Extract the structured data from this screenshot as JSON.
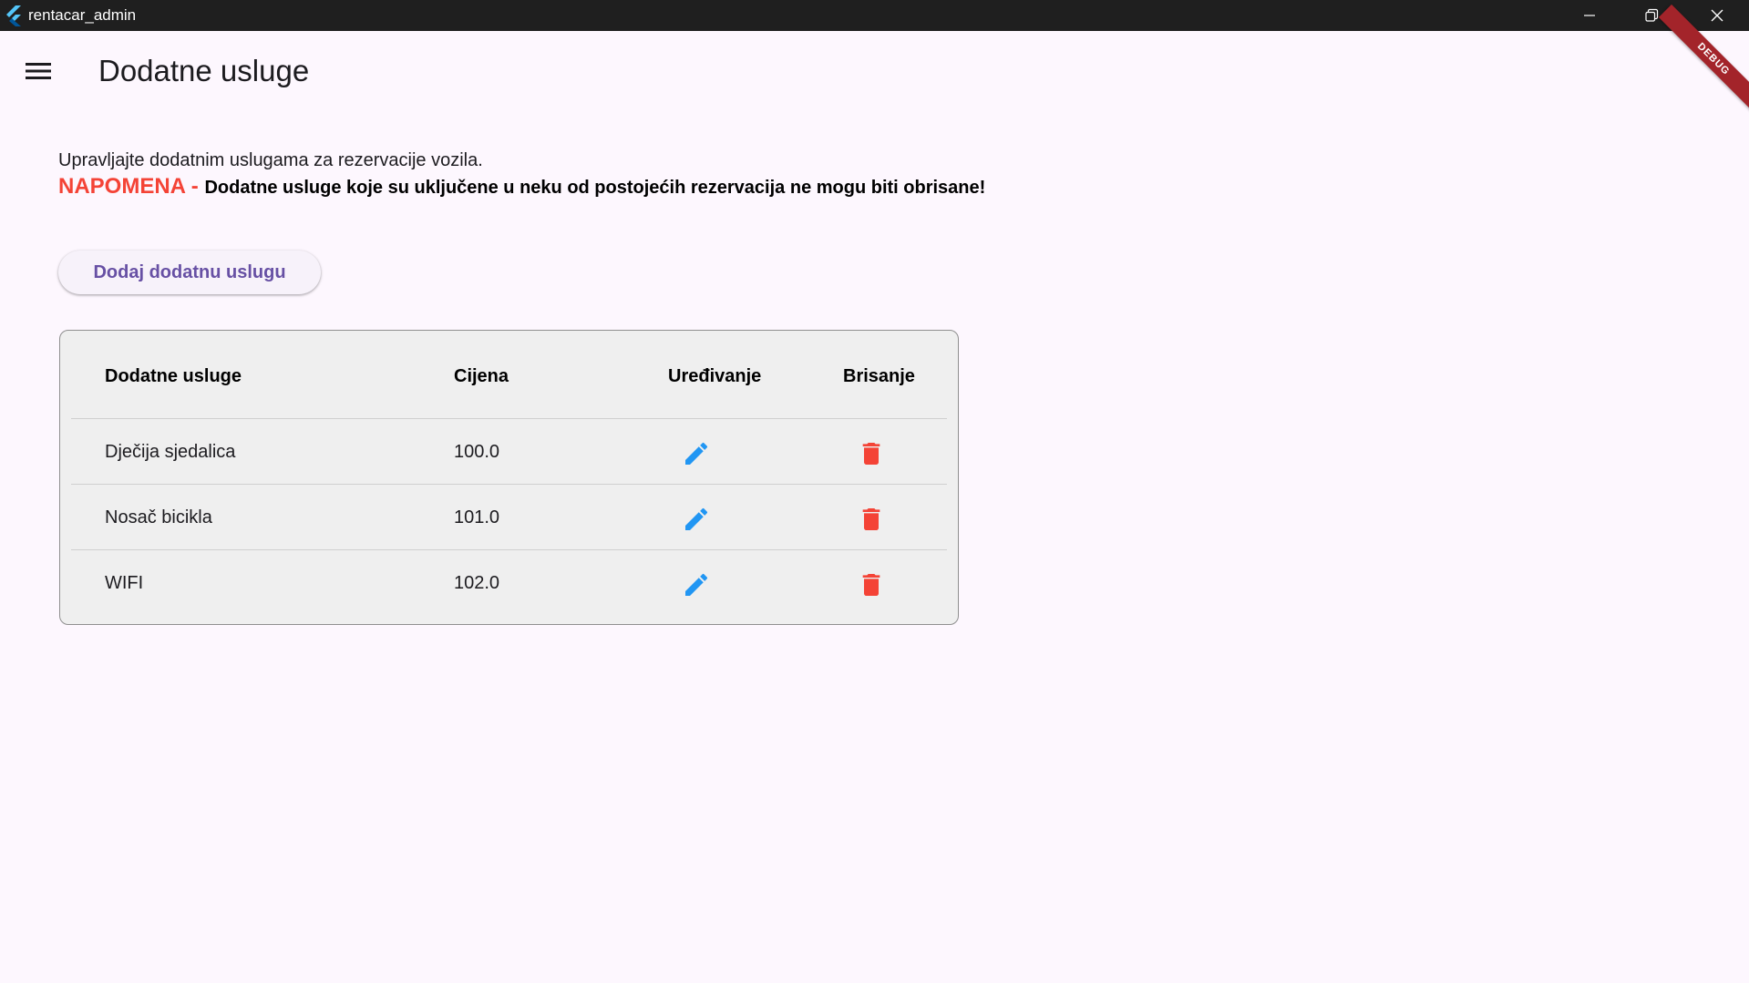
{
  "window": {
    "title": "rentacar_admin"
  },
  "debug_banner": "DEBUG",
  "appbar": {
    "title": "Dodatne usluge",
    "menu_icon": "menu-icon"
  },
  "intro_text": "Upravljajte dodatnim uslugama za rezervacije vozila.",
  "note": {
    "label": "NAPOMENA - ",
    "text": "Dodatne usluge koje su uključene u neku od postojećih rezervacija ne mogu biti obrisane!"
  },
  "add_button_label": "Dodaj dodatnu uslugu",
  "table": {
    "headers": {
      "name": "Dodatne usluge",
      "price": "Cijena",
      "edit": "Uređivanje",
      "delete": "Brisanje"
    },
    "rows": [
      {
        "name": "Dječija sjedalica",
        "price": "100.0"
      },
      {
        "name": "Nosač bicikla",
        "price": "101.0"
      },
      {
        "name": "WIFI",
        "price": "102.0"
      }
    ]
  },
  "colors": {
    "accent": "#6750a4",
    "note_red": "#f44336",
    "edit_blue": "#2196f3",
    "delete_red": "#f44336",
    "titlebar": "#1f1f1f",
    "background": "#fdf7fe"
  }
}
